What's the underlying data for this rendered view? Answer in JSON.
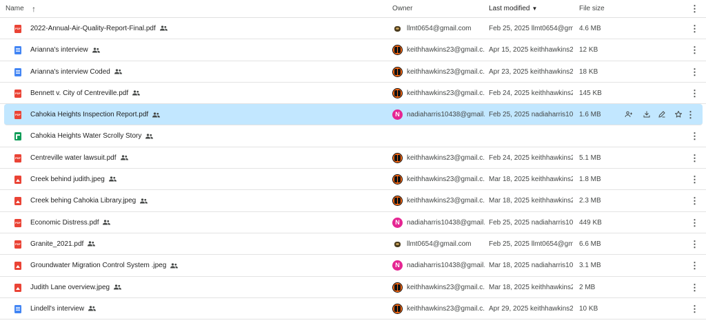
{
  "header": {
    "name": "Name",
    "sort_arrow": "↑",
    "owner": "Owner",
    "last_modified": "Last modified",
    "modified_caret": "▼",
    "file_size": "File size",
    "more": "⋮"
  },
  "rows": [
    {
      "name": "2022-Annual-Air-Quality-Report-Final.pdf",
      "type": "pdf",
      "avatar": "animal",
      "owner": "llmt0654@gmail.com",
      "modified": "Feb 25, 2025 llmt0654@gm...",
      "size": "4.6 MB"
    },
    {
      "name": "Arianna's interview",
      "type": "doc",
      "avatar": "bengal",
      "owner": "keithhawkins23@gmail.c...",
      "modified": "Apr 15, 2025 keithhawkins2...",
      "size": "12 KB"
    },
    {
      "name": "Arianna's interview Coded",
      "type": "doc",
      "avatar": "bengal",
      "owner": "keithhawkins23@gmail.c...",
      "modified": "Apr 23, 2025 keithhawkins2...",
      "size": "18 KB"
    },
    {
      "name": "Bennett v. City of Centreville.pdf",
      "type": "pdf",
      "avatar": "bengal",
      "owner": "keithhawkins23@gmail.c...",
      "modified": "Feb 24, 2025 keithhawkins2...",
      "size": "145 KB"
    },
    {
      "name": "Cahokia Heights Inspection Report.pdf",
      "type": "pdf",
      "avatar": "letter",
      "avatar_letter": "N",
      "owner": "nadiaharris10438@gmail....",
      "modified": "Feb 25, 2025 nadiaharris10...",
      "size": "1.6 MB",
      "selected": true
    },
    {
      "name": "Cahokia Heights Water Scrolly Story",
      "type": "sheet",
      "avatar": "none",
      "owner": "",
      "modified": "",
      "size": ""
    },
    {
      "name": "Centreville water lawsuit.pdf",
      "type": "pdf",
      "avatar": "bengal",
      "owner": "keithhawkins23@gmail.c...",
      "modified": "Feb 24, 2025 keithhawkins2...",
      "size": "5.1 MB"
    },
    {
      "name": "Creek behind judith.jpeg",
      "type": "img",
      "avatar": "bengal",
      "owner": "keithhawkins23@gmail.c...",
      "modified": "Mar 18, 2025 keithhawkins2...",
      "size": "1.8 MB"
    },
    {
      "name": "Creek behing Cahokia Library.jpeg",
      "type": "img",
      "avatar": "bengal",
      "owner": "keithhawkins23@gmail.c...",
      "modified": "Mar 18, 2025 keithhawkins2...",
      "size": "2.3 MB"
    },
    {
      "name": "Economic Distress.pdf",
      "type": "pdf",
      "avatar": "letter",
      "avatar_letter": "N",
      "owner": "nadiaharris10438@gmail....",
      "modified": "Feb 25, 2025 nadiaharris10...",
      "size": "449 KB"
    },
    {
      "name": "Granite_2021.pdf",
      "type": "pdf",
      "avatar": "animal",
      "owner": "llmt0654@gmail.com",
      "modified": "Feb 25, 2025 llmt0654@gm...",
      "size": "6.6 MB"
    },
    {
      "name": "Groundwater Migration Control System .jpeg",
      "type": "img",
      "avatar": "letter",
      "avatar_letter": "N",
      "owner": "nadiaharris10438@gmail....",
      "modified": "Mar 18, 2025 nadiaharris10...",
      "size": "3.1 MB"
    },
    {
      "name": "Judith Lane overview.jpeg",
      "type": "img",
      "avatar": "bengal",
      "owner": "keithhawkins23@gmail.c...",
      "modified": "Mar 18, 2025 keithhawkins2...",
      "size": "2 MB"
    },
    {
      "name": "Lindell's interview",
      "type": "doc",
      "avatar": "bengal",
      "owner": "keithhawkins23@gmail.c...",
      "modified": "Apr 29, 2025 keithhawkins2...",
      "size": "10 KB"
    }
  ],
  "row_actions": [
    "share-icon",
    "download-icon",
    "rename-icon",
    "star-icon"
  ],
  "more_glyph": "⋮",
  "colors": {
    "selected_row": "#c2e7ff",
    "pdf": "#ea4335",
    "doc": "#4285f4",
    "sheet": "#0f9d58",
    "avatar_n": "#e52592",
    "avatar_bengal": "#ff6a13"
  }
}
